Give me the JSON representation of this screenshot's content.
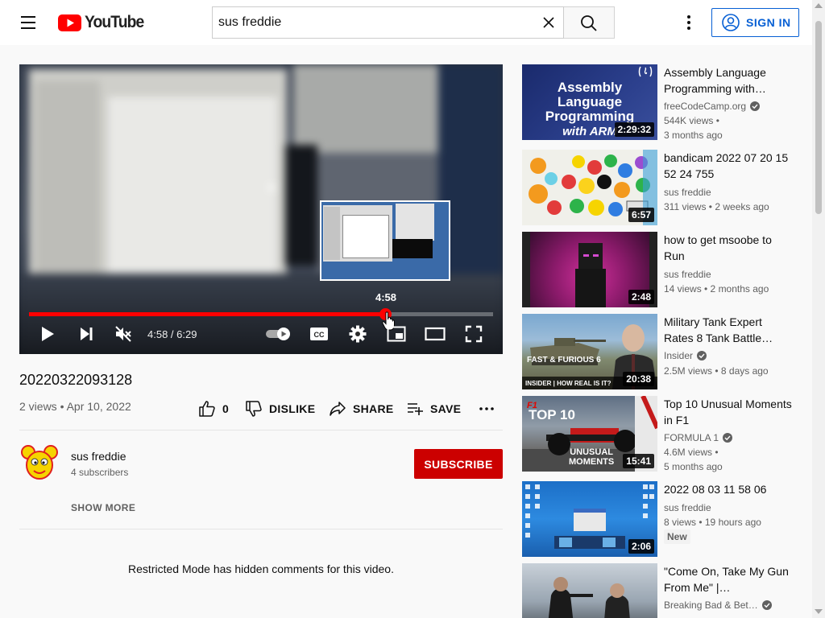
{
  "header": {
    "logo_text": "YouTube",
    "search_value": "sus freddie",
    "signin_label": "SIGN IN"
  },
  "player": {
    "preview_time": "4:58",
    "time_display": "4:58 / 6:29",
    "progress": 0.767
  },
  "video": {
    "title": "20220322093128",
    "meta": "2 views • Apr 10, 2022",
    "like_count": "0",
    "dislike_label": "DISLIKE",
    "share_label": "SHARE",
    "save_label": "SAVE"
  },
  "channel": {
    "name": "sus freddie",
    "subscribers": "4 subscribers",
    "subscribe_label": "SUBSCRIBE",
    "show_more_label": "SHOW MORE"
  },
  "comments_notice": "Restricted Mode has hidden comments for this video.",
  "recommendations": [
    {
      "title": "Assembly Language Programming with…",
      "channel": "freeCodeCamp.org",
      "verified": true,
      "views": "544K views •",
      "age": "3 months ago",
      "duration": "2:29:32",
      "thumb_text_1": "Assembly Language",
      "thumb_text_2": "Programming",
      "thumb_text_3": "with ARM"
    },
    {
      "title": "bandicam 2022 07 20 15 52 24 755",
      "channel": "sus freddie",
      "verified": false,
      "views": "311 views • 2 weeks ago",
      "age": "",
      "duration": "6:57"
    },
    {
      "title": "how to get msoobe to Run",
      "channel": "sus freddie",
      "verified": false,
      "views": "14 views • 2 months ago",
      "age": "",
      "duration": "2:48"
    },
    {
      "title": "Military Tank Expert Rates 8 Tank Battle…",
      "channel": "Insider",
      "verified": true,
      "views": "2.5M views • 8 days ago",
      "age": "",
      "duration": "20:38",
      "thumb_text_1": "FAST & FURIOUS 6",
      "thumb_text_2": "INSIDER | HOW REAL IS IT?"
    },
    {
      "title": "Top 10 Unusual Moments in F1",
      "channel": "FORMULA 1",
      "verified": true,
      "views": "4.6M views •",
      "age": "5 months ago",
      "duration": "15:41",
      "thumb_text_1": "TOP 10",
      "thumb_text_2": "UNUSUAL",
      "thumb_text_3": "MOMENTS"
    },
    {
      "title": "2022 08 03 11 58 06",
      "channel": "sus freddie",
      "verified": false,
      "views": "8 views • 19 hours ago",
      "age": "",
      "duration": "2:06",
      "badge": "New"
    },
    {
      "title": "\"Come On, Take My Gun From Me\" |…",
      "channel": "Breaking Bad & Bet…",
      "verified": true,
      "views": "",
      "age": "",
      "duration": ""
    }
  ]
}
